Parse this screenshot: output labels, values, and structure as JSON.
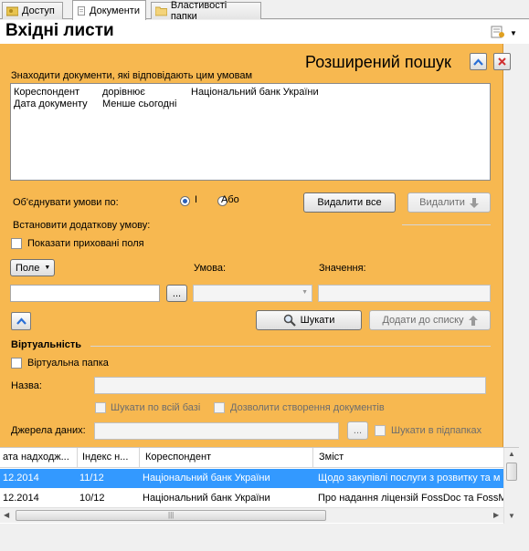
{
  "tabs": [
    {
      "label": "Доступ",
      "icon": "key-folder-icon",
      "active": false
    },
    {
      "label": "Документи",
      "icon": "document-icon",
      "active": true
    },
    {
      "label": "Властивості папки",
      "icon": "folder-icon",
      "active": false
    }
  ],
  "page": {
    "title": "Вхідні листи"
  },
  "search": {
    "title": "Розширений пошук",
    "caption": "Знаходити документи, які відповідають цим умовам",
    "conditions": [
      {
        "field": "Кореспондент",
        "op": "дорівнює",
        "value": "Національний банк України"
      },
      {
        "field": "Дата документу",
        "op": "Менше сьогодні",
        "value": ""
      }
    ],
    "combine_label": "Об'єднувати умови по:",
    "and_label": "І",
    "or_label": "Або",
    "delete_all": "Видалити все",
    "delete": "Видалити",
    "add_condition_label": "Встановити додаткову умову:",
    "show_hidden": "Показати приховані поля",
    "field_select": "Поле",
    "condition_label": "Умова:",
    "value_label": "Значення:",
    "browse": "...",
    "search_button": "Шукати",
    "add_to_list": "Додати до списку"
  },
  "virtual": {
    "section": "Віртуальність",
    "virtual_folder": "Віртуальна папка",
    "name_label": "Назва:",
    "search_all": "Шукати по всій базі",
    "allow_create": "Дозволити створення документів",
    "sources_label": "Джерела даних:",
    "browse": "...",
    "search_subfolders": "Шукати в підпапках"
  },
  "grid": {
    "columns": [
      "ата надходж...",
      "Індекс н...",
      "Кореспондент",
      "Зміст"
    ],
    "rows": [
      {
        "date": "12.2014",
        "index": "11/12",
        "correspondent": "Національний банк України",
        "content": "Щодо закупівлі послуги з розвитку та м",
        "selected": true
      },
      {
        "date": "12.2014",
        "index": "10/12",
        "correspondent": "Національний банк України",
        "content": "Про надання ліцензій FossDoc та FossMa",
        "selected": false
      }
    ]
  },
  "colors": {
    "panel": "#f7b850",
    "selection": "#3399ff",
    "close_red": "#d03030",
    "up_blue": "#2a6fd6"
  }
}
